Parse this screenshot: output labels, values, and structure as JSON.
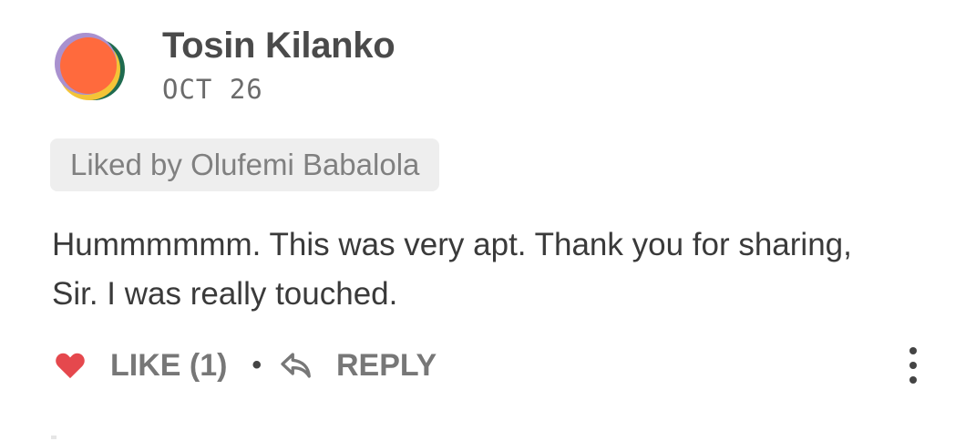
{
  "comment": {
    "author": "Tosin Kilanko",
    "date": "OCT 26",
    "liked_by": "Liked by Olufemi Babalola",
    "body": "Hummmmmm. This was very apt. Thank you for sharing, Sir. I was really touched.",
    "avatar_icon": "avatar-icon"
  },
  "actions": {
    "like_icon": "heart-icon",
    "like_label": "LIKE (1)",
    "separator": "•",
    "reply_icon": "reply-icon",
    "reply_label": "REPLY",
    "more_icon": "more-vertical-icon"
  },
  "colors": {
    "heart": "#e5484d",
    "avatar_primary": "#ff6a3d"
  }
}
